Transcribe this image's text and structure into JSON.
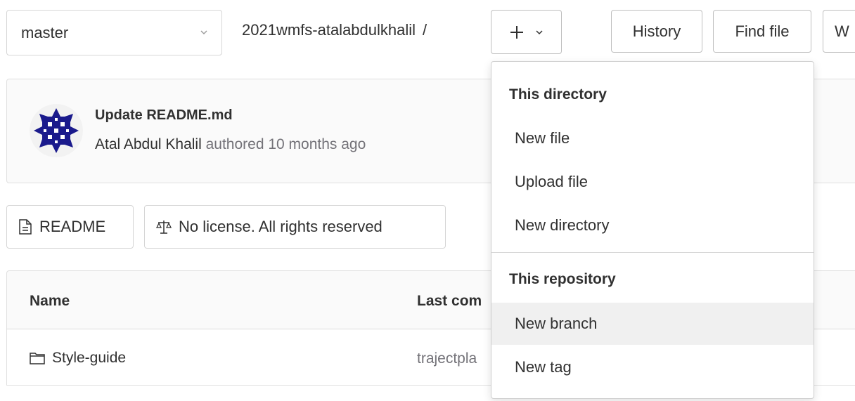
{
  "toolbar": {
    "branch": "master",
    "repo_name": "2021wmfs-atalabdulkhalil",
    "path_separator": "/",
    "add_button": "+",
    "history_label": "History",
    "find_file_label": "Find file",
    "web_ide_label": "W"
  },
  "commit": {
    "title": "Update README.md",
    "author": "Atal Abdul Khalil",
    "action_time": " authored 10 months ago"
  },
  "badges": {
    "readme": "README",
    "license": "No license. All rights reserved"
  },
  "table": {
    "headers": {
      "name": "Name",
      "last_commit": "Last com"
    },
    "rows": [
      {
        "name": "Style-guide",
        "last_commit": "trajectpla"
      }
    ]
  },
  "dropdown": {
    "section_directory": "This directory",
    "directory_items": [
      "New file",
      "Upload file",
      "New directory"
    ],
    "section_repository": "This repository",
    "repository_items": [
      "New branch",
      "New tag"
    ],
    "hovered_item": "New branch"
  },
  "colors": {
    "text": "#303030",
    "muted": "#737278",
    "avatar": "#1a1a8c",
    "border": "#d6d6d6",
    "hover": "#f0f0f0"
  },
  "icons": [
    "chevron-down-icon",
    "plus-icon",
    "file-text-icon",
    "scale-icon",
    "folder-icon"
  ]
}
